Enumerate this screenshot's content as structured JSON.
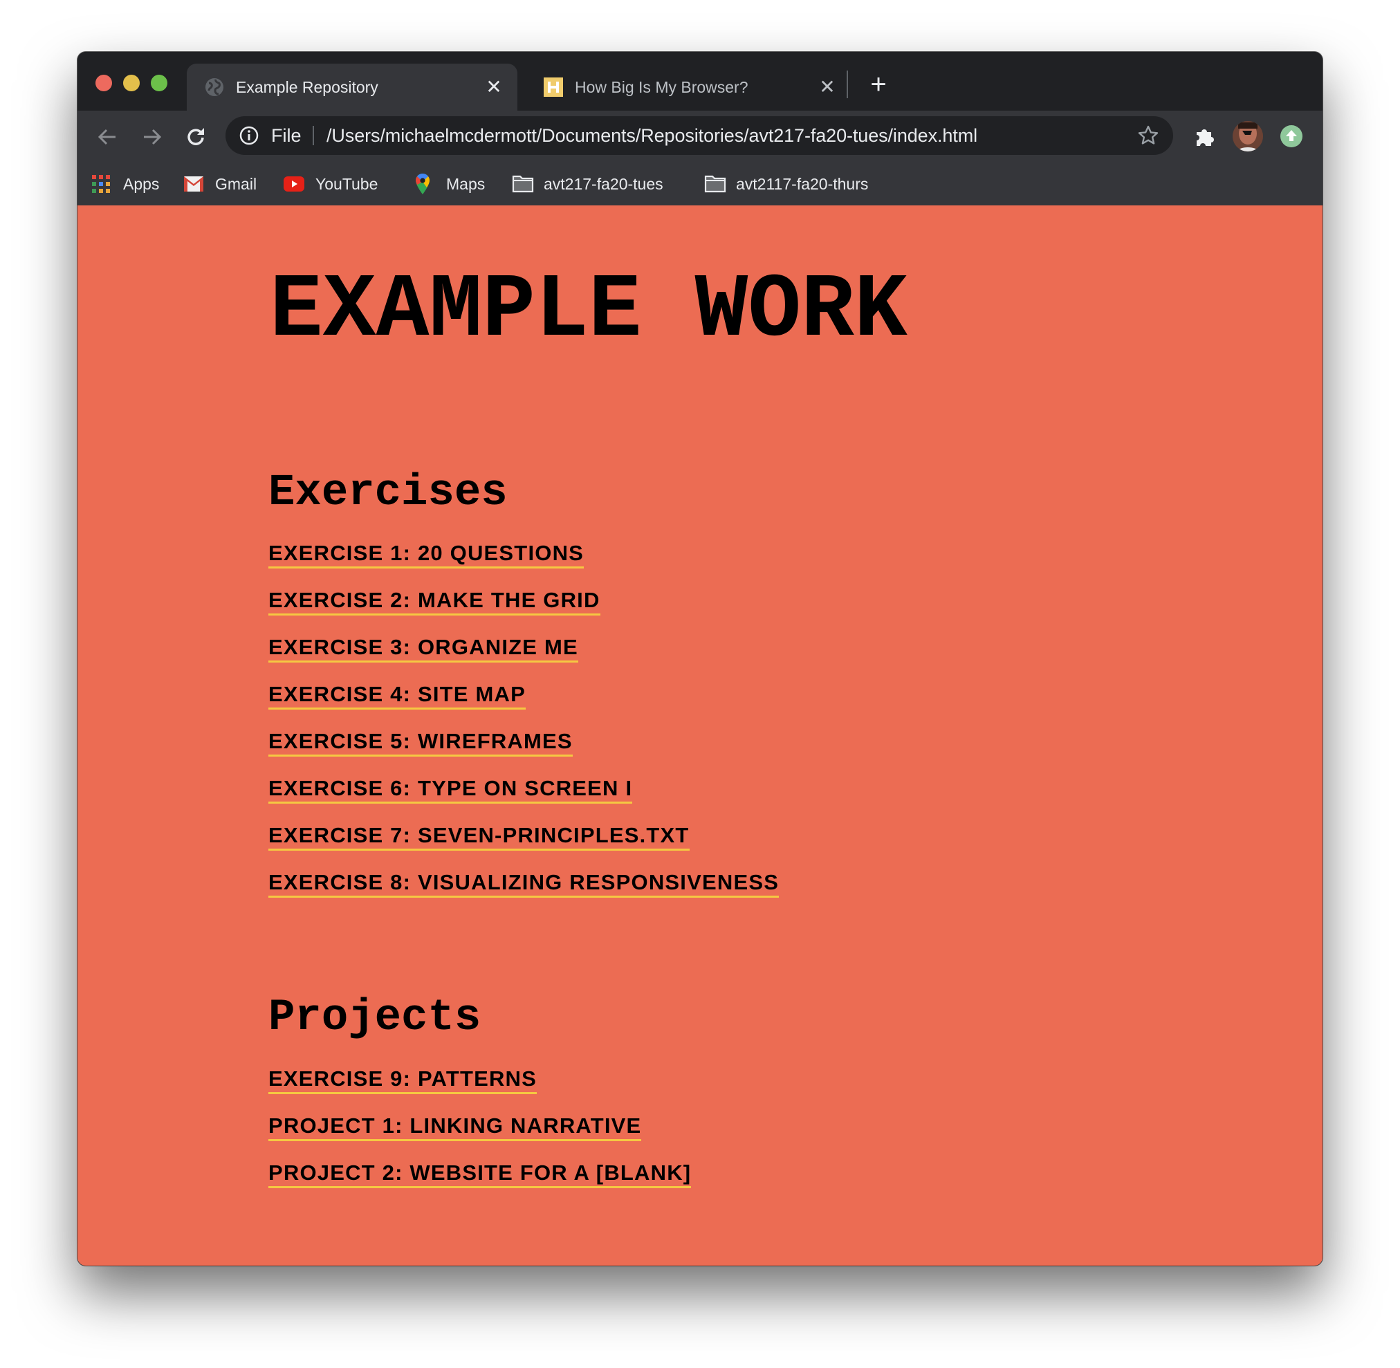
{
  "browser": {
    "tabs": [
      {
        "title": "Example Repository",
        "favicon": "globe-icon",
        "active": true
      },
      {
        "title": "How Big Is My Browser?",
        "favicon": "h-letter-icon",
        "active": false
      }
    ],
    "new_tab_label": "+",
    "close_glyph": "✕",
    "omnibox": {
      "scheme_label": "File",
      "url": "/Users/michaelmcdermott/Documents/Repositories/avt217-fa20-tues/index.html"
    },
    "bookmarks": [
      {
        "label": "Apps",
        "icon": "apps-grid-icon"
      },
      {
        "label": "Gmail",
        "icon": "gmail-icon"
      },
      {
        "label": "YouTube",
        "icon": "youtube-icon"
      },
      {
        "label": "Maps",
        "icon": "maps-pin-icon"
      },
      {
        "label": "avt217-fa20-tues",
        "icon": "folder-icon"
      },
      {
        "label": "avt2117-fa20-thurs",
        "icon": "folder-icon"
      }
    ],
    "colors": {
      "frame": "#202124",
      "toolbar": "#35363a",
      "traffic_red": "#ed6a5e",
      "traffic_yellow": "#e3bf4b",
      "traffic_green": "#6cc04a"
    }
  },
  "page": {
    "title": "EXAMPLE WORK",
    "background": "#ec6c53",
    "link_underline": "#f5c842",
    "sections": [
      {
        "heading": "Exercises",
        "links": [
          "EXERCISE 1: 20 QUESTIONS",
          "EXERCISE 2: MAKE THE GRID",
          "EXERCISE 3: ORGANIZE ME",
          "EXERCISE 4: SITE MAP",
          "EXERCISE 5: WIREFRAMES",
          "EXERCISE 6: TYPE ON SCREEN I",
          "EXERCISE 7: SEVEN-PRINCIPLES.TXT",
          "EXERCISE 8: VISUALIZING RESPONSIVENESS"
        ]
      },
      {
        "heading": "Projects",
        "links": [
          "EXERCISE 9: PATTERNS",
          "PROJECT 1: LINKING NARRATIVE",
          "PROJECT 2: WEBSITE FOR A [BLANK]"
        ]
      }
    ]
  }
}
